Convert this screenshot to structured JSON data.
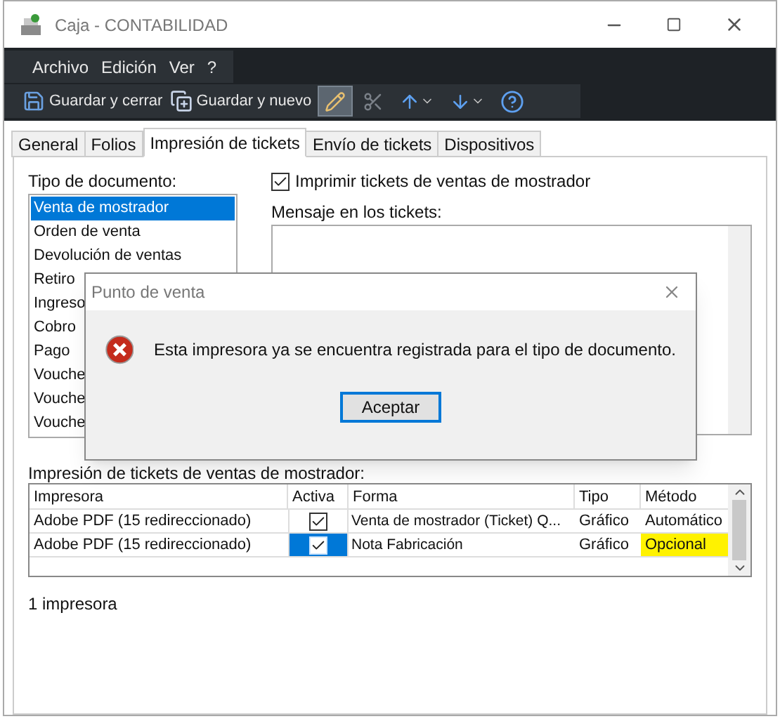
{
  "window": {
    "title": "Caja - CONTABILIDAD"
  },
  "menu": [
    "Archivo",
    "Edición",
    "Ver",
    "?"
  ],
  "toolbar": [
    {
      "kind": "save",
      "label": "Guardar y cerrar"
    },
    {
      "kind": "save-new",
      "label": "Guardar y nuevo"
    },
    {
      "kind": "edit",
      "pressed": true
    },
    {
      "kind": "cut",
      "pressed": false
    },
    {
      "kind": "up",
      "pressed": false
    },
    {
      "kind": "down",
      "pressed": false
    },
    {
      "kind": "help",
      "pressed": false
    }
  ],
  "tabs": [
    {
      "label": "General",
      "selected": false
    },
    {
      "label": "Folios",
      "selected": false
    },
    {
      "label": "Impresión de tickets",
      "selected": true
    },
    {
      "label": "Envío de tickets",
      "selected": false
    },
    {
      "label": "Dispositivos",
      "selected": false
    }
  ],
  "document_type": {
    "label": "Tipo de documento:",
    "items": [
      {
        "label": "Venta de mostrador",
        "selected": true
      },
      {
        "label": "Orden de venta",
        "selected": false
      },
      {
        "label": "Devolución de ventas",
        "selected": false
      },
      {
        "label": "Retiro",
        "selected": false
      },
      {
        "label": "Ingreso",
        "selected": false
      },
      {
        "label": "Cobro",
        "selected": false
      },
      {
        "label": "Pago",
        "selected": false
      },
      {
        "label": "Vouche",
        "selected": false
      },
      {
        "label": "Vouche",
        "selected": false
      },
      {
        "label": "Vouche",
        "selected": false
      }
    ]
  },
  "print_checkbox": {
    "label": "Imprimir tickets de ventas de mostrador",
    "checked": true
  },
  "message": {
    "label": "Mensaje en los tickets:"
  },
  "printers": {
    "label": "Impresión de tickets de ventas de mostrador:",
    "columns": [
      "Impresora",
      "Activa",
      "Forma",
      "Tipo",
      "Método"
    ],
    "rows": [
      {
        "printer": "Adobe PDF (15 redireccionado)",
        "active": true,
        "active_focused": false,
        "form": "Venta de mostrador (Ticket) Q...",
        "type": "Gráfico",
        "method": "Automático",
        "highlighted": false
      },
      {
        "printer": "Adobe PDF (15 redireccionado)",
        "active": true,
        "active_focused": true,
        "form": "Nota Fabricación",
        "type": "Gráfico",
        "method": "Opcional",
        "highlighted": true
      }
    ]
  },
  "status": "1 impresora",
  "dialog": {
    "title": "Punto de venta",
    "message": "Esta impresora ya se encuentra registrada para el tipo de documento.",
    "button": "Aceptar"
  }
}
